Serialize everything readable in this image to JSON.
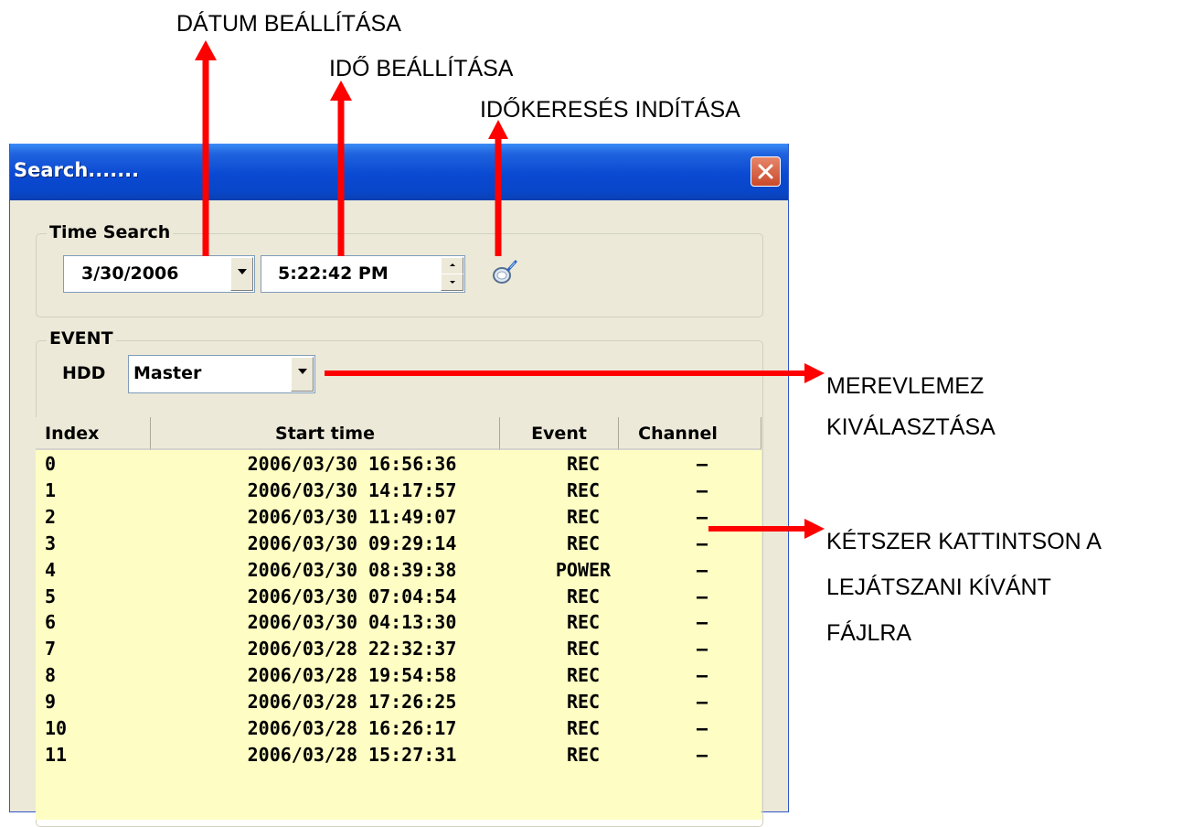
{
  "annotations": {
    "date_setting": "DÁTUM BEÁLLÍTÁSA",
    "time_setting": "IDŐ BEÁLLÍTÁSA",
    "start_time_search": "IDŐKERESÉS INDÍTÁSA",
    "select_hdd_line1": "MEREVLEMEZ",
    "select_hdd_line2": "KIVÁLASZTÁSA",
    "double_click_line1": "KÉTSZER KATTINTSON A",
    "double_click_line2": "LEJÁTSZANI KÍVÁNT",
    "double_click_line3": "FÁJLRA"
  },
  "window": {
    "title": "Search.......",
    "close_icon": "close-x-icon"
  },
  "time_search": {
    "group_label": "Time Search",
    "date_value": "3/30/2006",
    "time_value": "5:22:42 PM",
    "search_icon": "magnifier-search-icon"
  },
  "event": {
    "group_label": "EVENT",
    "hdd_label": "HDD",
    "hdd_value": "Master"
  },
  "table": {
    "columns": [
      "Index",
      "Start time",
      "Event",
      "Channel"
    ],
    "rows": [
      {
        "index": "0",
        "start": "2006/03/30  16:56:36",
        "event": "REC",
        "channel": "–"
      },
      {
        "index": "1",
        "start": "2006/03/30  14:17:57",
        "event": "REC",
        "channel": "–"
      },
      {
        "index": "2",
        "start": "2006/03/30  11:49:07",
        "event": "REC",
        "channel": "–"
      },
      {
        "index": "3",
        "start": "2006/03/30  09:29:14",
        "event": "REC",
        "channel": "–"
      },
      {
        "index": "4",
        "start": "2006/03/30  08:39:38",
        "event": "POWER",
        "channel": "–"
      },
      {
        "index": "5",
        "start": "2006/03/30  07:04:54",
        "event": "REC",
        "channel": "–"
      },
      {
        "index": "6",
        "start": "2006/03/30  04:13:30",
        "event": "REC",
        "channel": "–"
      },
      {
        "index": "7",
        "start": "2006/03/28  22:32:37",
        "event": "REC",
        "channel": "–"
      },
      {
        "index": "8",
        "start": "2006/03/28  19:54:58",
        "event": "REC",
        "channel": "–"
      },
      {
        "index": "9",
        "start": "2006/03/28  17:26:25",
        "event": "REC",
        "channel": "–"
      },
      {
        "index": "10",
        "start": "2006/03/28  16:26:17",
        "event": "REC",
        "channel": "–"
      },
      {
        "index": "11",
        "start": "2006/03/28  15:27:31",
        "event": "REC",
        "channel": "–"
      }
    ]
  },
  "colors": {
    "arrow": "#ff0000",
    "list_background": "#fefdc4",
    "titlebar": "#0a49d2",
    "dialog_background": "#ece9d8"
  }
}
